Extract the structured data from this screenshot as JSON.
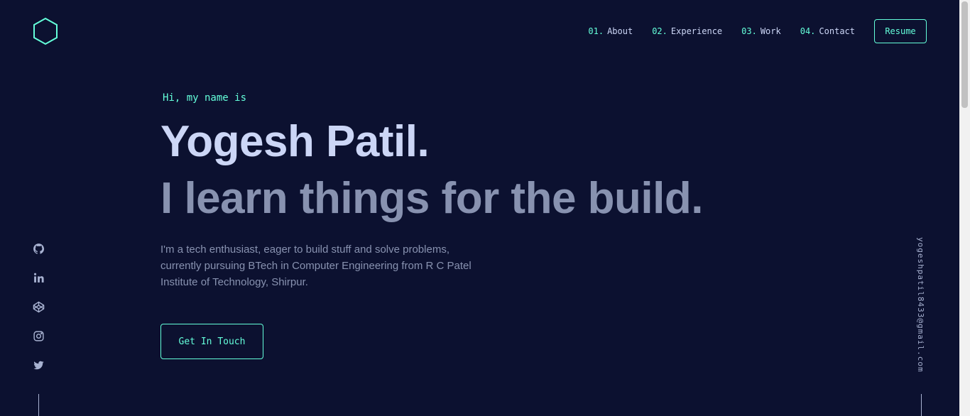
{
  "header": {
    "nav": [
      {
        "num": "01.",
        "label": "About"
      },
      {
        "num": "02.",
        "label": "Experience"
      },
      {
        "num": "03.",
        "label": "Work"
      },
      {
        "num": "04.",
        "label": "Contact"
      }
    ],
    "resume_label": "Resume"
  },
  "hero": {
    "greeting": "Hi, my name is",
    "name": "Yogesh Patil.",
    "tagline": "I learn things for the build.",
    "bio": "I'm a tech enthusiast, eager to build stuff and solve problems, currently pursuing BTech in Computer Engineering from R C Patel Institute of Technology, Shirpur.",
    "cta_label": "Get In Touch"
  },
  "social": [
    {
      "icon": "github-icon"
    },
    {
      "icon": "linkedin-icon"
    },
    {
      "icon": "codepen-icon"
    },
    {
      "icon": "instagram-icon"
    },
    {
      "icon": "twitter-icon"
    }
  ],
  "email": "yogeshpatil8433@gmail.com",
  "colors": {
    "background": "#0c1130",
    "accent": "#64ffda",
    "heading": "#ccd6f6",
    "muted": "#8892b0"
  }
}
